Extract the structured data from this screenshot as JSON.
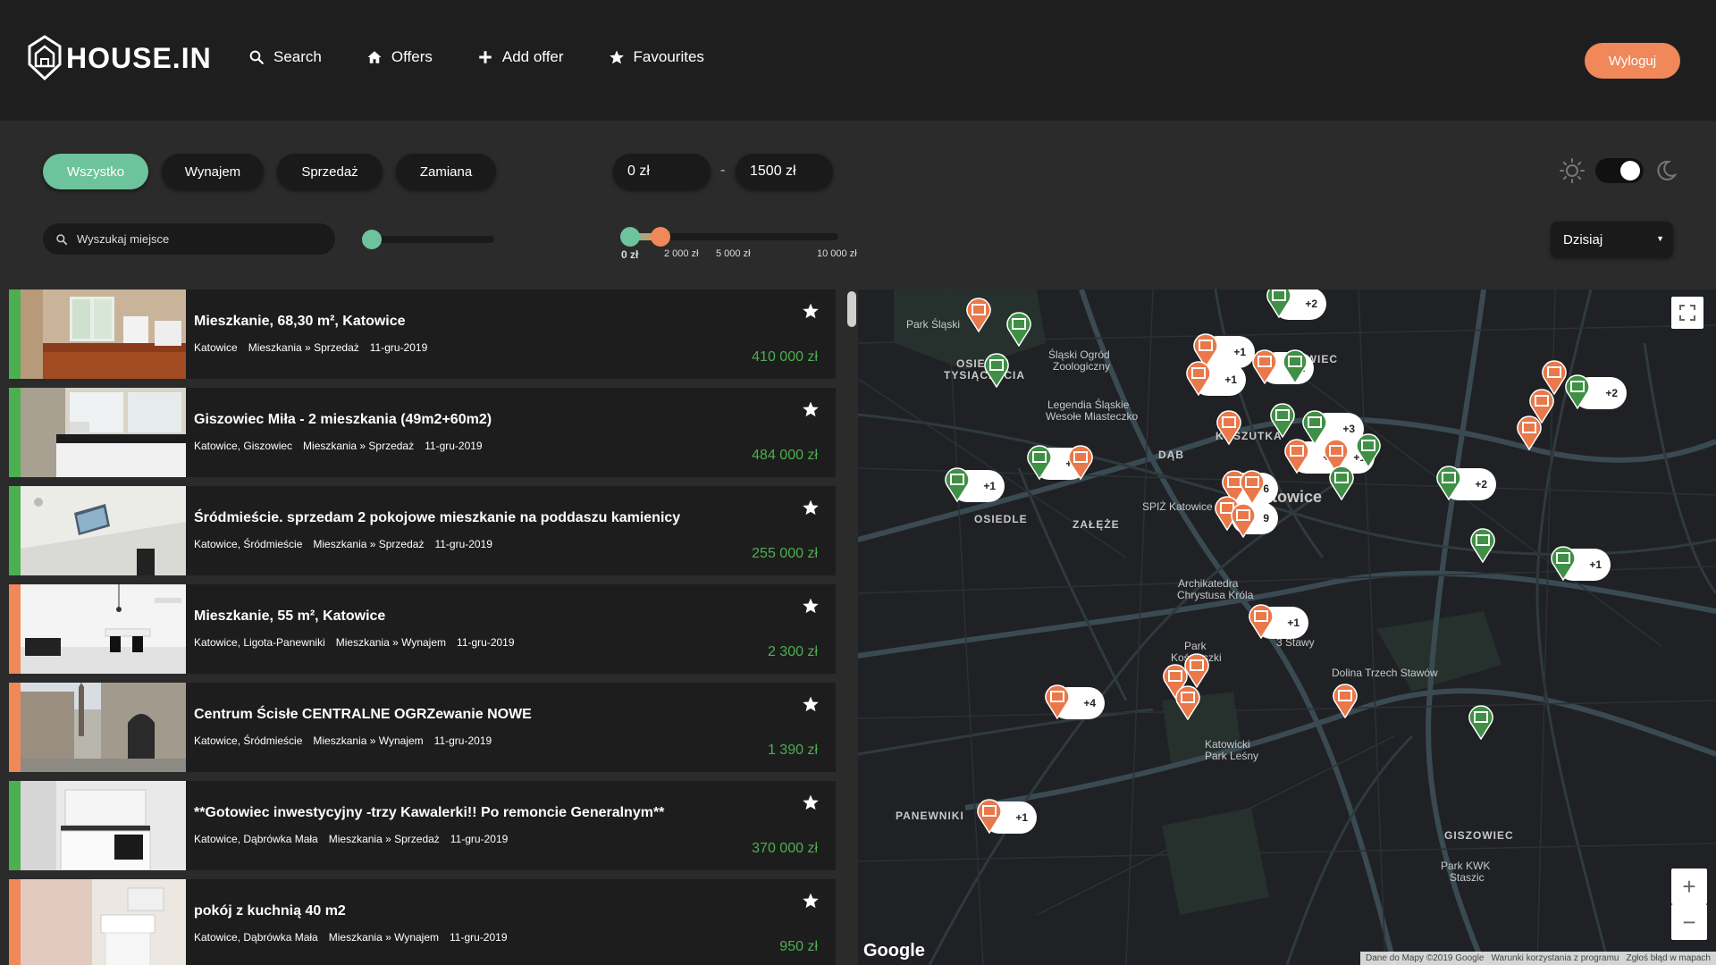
{
  "header": {
    "logo_text": "HOUSE.IN",
    "nav": [
      {
        "label": "Search",
        "icon": "search-icon"
      },
      {
        "label": "Offers",
        "icon": "home-icon"
      },
      {
        "label": "Add offer",
        "icon": "plus-icon"
      },
      {
        "label": "Favourites",
        "icon": "star-icon"
      }
    ],
    "logout_label": "Wyloguj",
    "accent_color": "#f0885a"
  },
  "filters": {
    "type_pills": [
      {
        "label": "Wszystko",
        "active": true
      },
      {
        "label": "Wynajem",
        "active": false
      },
      {
        "label": "Sprzedaż",
        "active": false
      },
      {
        "label": "Zamiana",
        "active": false
      }
    ],
    "price_min": "0 zł",
    "price_max": "1500 zł",
    "price_separator": "-",
    "search_placeholder": "Wyszukaj miejsce",
    "price_ticks": [
      "0 zł",
      "2 000 zł",
      "5 000 zł",
      "10 000 zł"
    ],
    "date_select": "Dzisiaj",
    "theme": "dark",
    "active_color": "#6dc39b"
  },
  "listings": [
    {
      "title": "Mieszkanie, 68,30 m², Katowice",
      "location": "Katowice",
      "category": "Mieszkania » Sprzedaż",
      "date": "11-gru-2019",
      "price": "410 000 zł",
      "type": "sale",
      "photo": "living-room"
    },
    {
      "title": "Giszowiec Miła - 2 mieszkania (49m2+60m2)",
      "location": "Katowice, Giszowiec",
      "category": "Mieszkania » Sprzedaż",
      "date": "11-gru-2019",
      "price": "484 000 zł",
      "type": "sale",
      "photo": "kitchen"
    },
    {
      "title": "Śródmieście. sprzedam 2 pokojowe mieszkanie na poddaszu kamienicy",
      "location": "Katowice, Śródmieście",
      "category": "Mieszkania » Sprzedaż",
      "date": "11-gru-2019",
      "price": "255 000 zł",
      "type": "sale",
      "photo": "attic"
    },
    {
      "title": "Mieszkanie, 55 m², Katowice",
      "location": "Katowice, Ligota-Panewniki",
      "category": "Mieszkania » Wynajem",
      "date": "11-gru-2019",
      "price": "2 300 zł",
      "type": "rent",
      "photo": "white-room"
    },
    {
      "title": "Centrum Ścisłe CENTRALNE OGRZewanie NOWE",
      "location": "Katowice, Śródmieście",
      "category": "Mieszkania » Wynajem",
      "date": "11-gru-2019",
      "price": "1 390 zł",
      "type": "rent",
      "photo": "street"
    },
    {
      "title": "**Gotowiec inwestycyjny -trzy Kawalerki!! Po remoncie Generalnym**",
      "location": "Katowice, Dąbrówka Mała",
      "category": "Mieszkania » Sprzedaż",
      "date": "11-gru-2019",
      "price": "370 000 zł",
      "type": "sale",
      "photo": "kitchenette"
    },
    {
      "title": "pokój z kuchnią 40 m2",
      "location": "Katowice, Dąbrówka Mała",
      "category": "Mieszkania » Wynajem",
      "date": "11-gru-2019",
      "price": "950 zł",
      "type": "rent",
      "photo": "bathroom"
    }
  ],
  "map": {
    "labels": [
      {
        "text": "Park Śląski",
        "caps": false
      },
      {
        "text": "OSIEDLE",
        "caps": true
      },
      {
        "text": "TYSIĄCLECIA",
        "caps": true
      },
      {
        "text": "Śląski Ogród",
        "caps": false
      },
      {
        "text": "Zoologiczny",
        "caps": false
      },
      {
        "text": "WEŁNOWIEC",
        "caps": true
      },
      {
        "text": "Legendia Śląskie",
        "caps": false
      },
      {
        "text": "Wesołe Miasteczko",
        "caps": false
      },
      {
        "text": "DĄB",
        "caps": true
      },
      {
        "text": "KOSZUTKA",
        "caps": true
      },
      {
        "text": "OSIEDLE",
        "caps": true
      },
      {
        "text": "ZAŁĘŻE",
        "caps": true
      },
      {
        "text": "SPIŻ Katowice",
        "caps": false
      },
      {
        "text": "Katowice",
        "caps": false
      },
      {
        "text": "Archikatedra",
        "caps": false
      },
      {
        "text": "Chrystusa Króla",
        "caps": false
      },
      {
        "text": "Park",
        "caps": false
      },
      {
        "text": "Kościuszki",
        "caps": false
      },
      {
        "text": "3 Stawy",
        "caps": false
      },
      {
        "text": "Dolina Trzech Stawów",
        "caps": false
      },
      {
        "text": "Katowicki",
        "caps": false
      },
      {
        "text": "Park Leśny",
        "caps": false
      },
      {
        "text": "PANEWNIKI",
        "caps": true
      },
      {
        "text": "GISZOWIEC",
        "caps": true
      },
      {
        "text": "Park KWK",
        "caps": false
      },
      {
        "text": "Staszic",
        "caps": false
      }
    ],
    "clusters": [
      "+2",
      "+1",
      "+1",
      "+1",
      "+1",
      "+1",
      "+3",
      "+1",
      "+1",
      "+2",
      "+2",
      "6",
      "9",
      "+1",
      "+1",
      "+4",
      "+1"
    ],
    "google_logo": "Google",
    "attribution": [
      "Dane do Mapy ©2019 Google",
      "Warunki korzystania z programu",
      "Zgłoś błąd w mapach"
    ],
    "zoom_in": "+",
    "zoom_out": "−"
  }
}
